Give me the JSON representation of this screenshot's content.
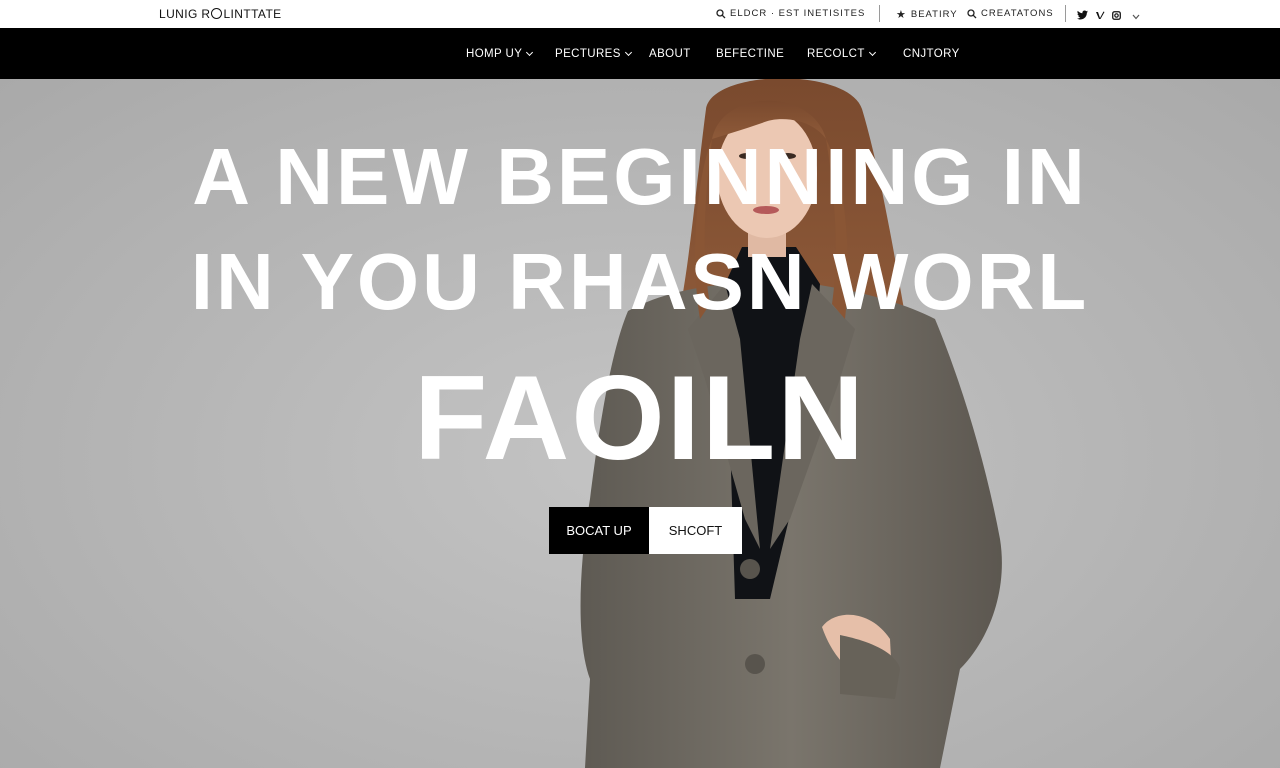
{
  "brand": {
    "logo_left": "LUNIG R",
    "logo_right": "LINTTATE"
  },
  "utility": {
    "search_label": "ELDCR · EST INETISITES",
    "beatiry_label": "BEATIRY",
    "creatatons_label": "CREATATONS"
  },
  "social": {
    "icons": [
      "twitter-icon",
      "vimeo-icon",
      "instagram-icon",
      "chevron-down-icon"
    ]
  },
  "nav": {
    "items": [
      {
        "label": "HOMP UY",
        "dropdown": true
      },
      {
        "label": "PECTURES",
        "dropdown": true
      },
      {
        "label": "ABOUT",
        "dropdown": false
      },
      {
        "label": "BEFECTINE",
        "dropdown": false
      },
      {
        "label": "RECOLCT",
        "dropdown": true
      },
      {
        "label": "CNJTORY",
        "dropdown": false
      }
    ]
  },
  "hero": {
    "line1": "A NEW BEGINNING IN",
    "line2": "IN YOU RHASN WORL",
    "line3": "FAOILN",
    "cta_primary": "BOCAT UP",
    "cta_secondary": "SHCOFT"
  },
  "colors": {
    "nav_bg": "#000000",
    "hero_bg": "#b8b8b8",
    "coat": "#6f6a62",
    "text_light": "#ffffff"
  }
}
